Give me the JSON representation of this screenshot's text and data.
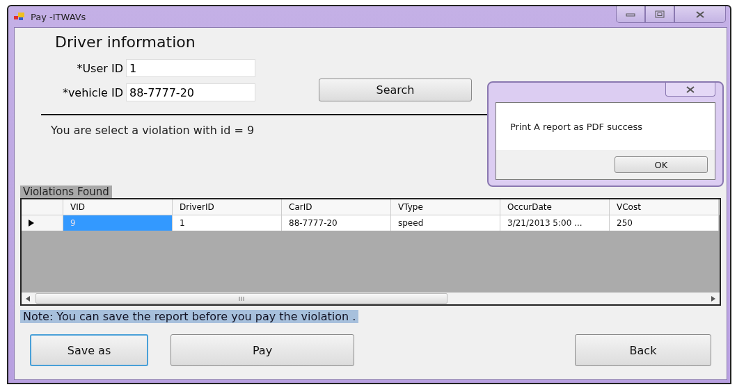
{
  "window": {
    "title": "Pay -ITWAVs"
  },
  "heading": "Driver information",
  "fields": [
    {
      "label": "*User ID",
      "value": "1"
    },
    {
      "label": "*vehicle ID",
      "value": "88-7777-20"
    }
  ],
  "search_button": "Search",
  "message": "You are select a violation with id = 9",
  "grid": {
    "caption": "Violations Found",
    "columns": [
      "VID",
      "DriverID",
      "CarID",
      "VType",
      "OccurDate",
      "VCost"
    ],
    "rows": [
      {
        "current": true,
        "cells": [
          {
            "text": "9",
            "selected": true
          },
          {
            "text": "1",
            "selected": false
          },
          {
            "text": "88-7777-20",
            "selected": false
          },
          {
            "text": "speed",
            "selected": false
          },
          {
            "text": "3/21/2013 5:00 ...",
            "selected": false
          },
          {
            "text": "250",
            "selected": false
          }
        ]
      }
    ]
  },
  "note": "Note: You can save the report before you pay the violation .",
  "buttons": [
    {
      "label": "Save as",
      "focused": true
    },
    {
      "label": "Pay",
      "focused": false
    },
    {
      "label": "Back",
      "focused": false
    }
  ],
  "dialog": {
    "message": "Print A report as PDF success",
    "button": "OK"
  }
}
